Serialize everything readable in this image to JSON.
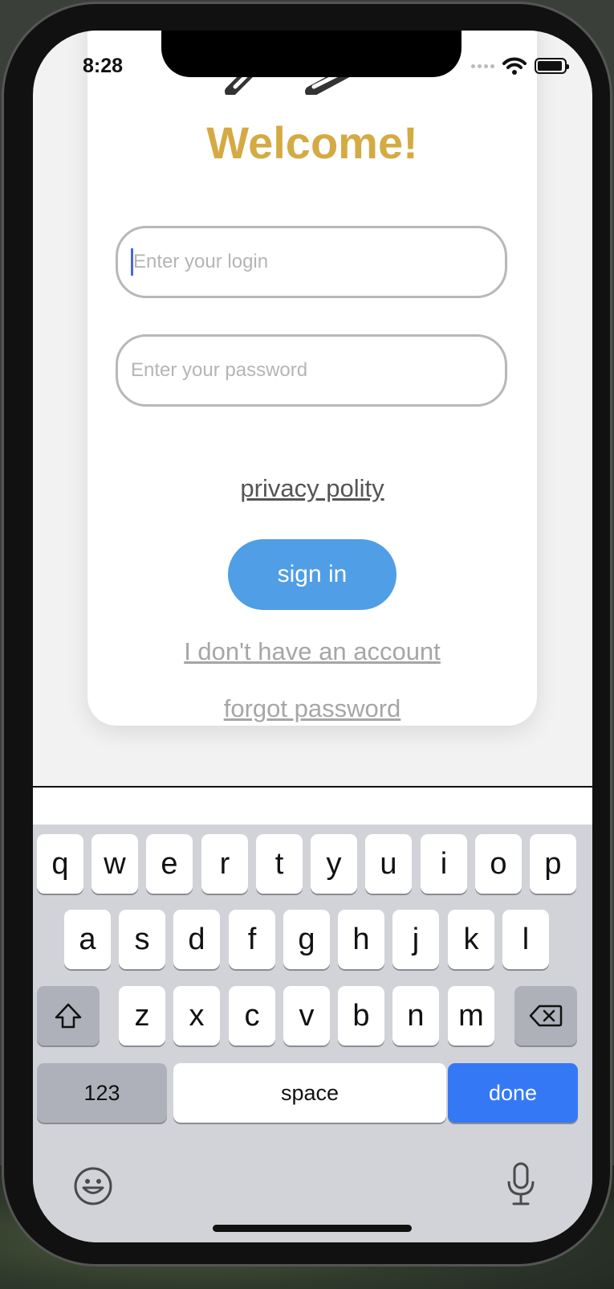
{
  "status": {
    "time": "8:28"
  },
  "card": {
    "title": "Welcome!",
    "login_placeholder": "Enter your login",
    "password_placeholder": "Enter your password",
    "privacy_link": "privacy polity",
    "signin_label": "sign in",
    "no_account_link": "I don't have an account",
    "forgot_link": "forgot password"
  },
  "colors": {
    "title": "#d4aa43",
    "signin_button": "#4f9ee6",
    "done_key": "#3478f6"
  },
  "keyboard": {
    "row1": [
      "q",
      "w",
      "e",
      "r",
      "t",
      "y",
      "u",
      "i",
      "o",
      "p"
    ],
    "row2": [
      "a",
      "s",
      "d",
      "f",
      "g",
      "h",
      "j",
      "k",
      "l"
    ],
    "row3": [
      "z",
      "x",
      "c",
      "v",
      "b",
      "n",
      "m"
    ],
    "numbers_key": "123",
    "space_key": "space",
    "done_key": "done",
    "icons": [
      "shift-icon",
      "delete-icon",
      "emoji-icon",
      "microphone-icon"
    ]
  }
}
